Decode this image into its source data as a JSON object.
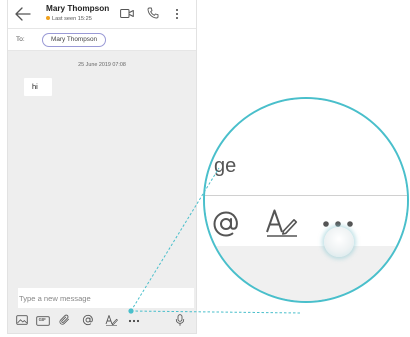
{
  "header": {
    "contact_name": "Mary Thompson",
    "last_seen": "Last seen 15:25",
    "back_icon": "arrow-left-icon",
    "video_icon": "video-camera-icon",
    "call_icon": "phone-icon",
    "more_icon": "more-vertical-icon"
  },
  "recipients": {
    "label": "To:",
    "chips": [
      "Mary Thompson"
    ]
  },
  "conversation": {
    "date": "25 June 2019 07:08",
    "messages": [
      {
        "text": "hi"
      }
    ]
  },
  "composer": {
    "placeholder": "Type a new message",
    "toolbar_icons": [
      "image-icon",
      "gif-icon",
      "attach-icon",
      "mention-icon",
      "format-icon",
      "more-options-icon",
      "microphone-icon"
    ],
    "gif_label": "GIF"
  },
  "magnifier": {
    "partial_placeholder": "ge",
    "icons": [
      "mention-icon",
      "format-icon",
      "more-options-icon"
    ]
  },
  "colors": {
    "accent": "#49bfcb",
    "status_dot": "#f0a11e",
    "chip_border": "#9a9ad6",
    "chat_background": "#eeeeee"
  }
}
